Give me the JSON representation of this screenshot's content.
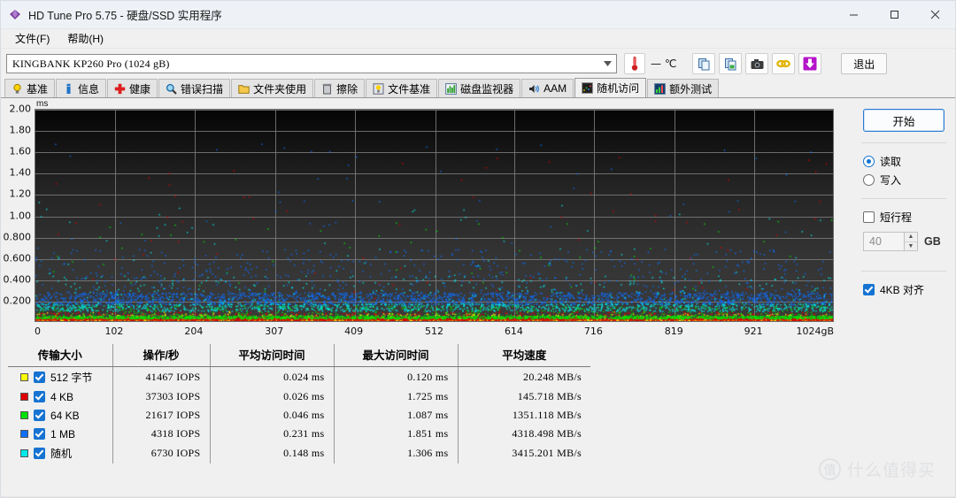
{
  "window": {
    "title": "HD Tune Pro 5.75 - 硬盘/SSD 实用程序",
    "app_icon": "hdtune-diamond-icon",
    "minimize": "—",
    "maximize": "☐",
    "close": "✕"
  },
  "menu": {
    "items": [
      {
        "label": "文件(F)",
        "name": "menu-file"
      },
      {
        "label": "帮助(H)",
        "name": "menu-help"
      }
    ]
  },
  "toolbar": {
    "drive": "KINGBANK KP260 Pro (1024 gB)",
    "dropdown_arrow": "▼",
    "temperature": "— ℃",
    "buttons": [
      {
        "name": "copy-button",
        "icon": "copy-icon"
      },
      {
        "name": "copy-image-button",
        "icon": "copy-image-icon"
      },
      {
        "name": "screenshot-button",
        "icon": "camera-icon"
      },
      {
        "name": "link-button",
        "icon": "link-icon"
      },
      {
        "name": "save-button",
        "icon": "download-arrow-icon"
      }
    ],
    "exit_label": "退出"
  },
  "tabs": [
    {
      "label": "基准",
      "icon": "bulb-icon",
      "active": false
    },
    {
      "label": "信息",
      "icon": "info-icon",
      "active": false
    },
    {
      "label": "健康",
      "icon": "health-cross-icon",
      "active": false
    },
    {
      "label": "错误扫描",
      "icon": "magnifier-icon",
      "active": false
    },
    {
      "label": "文件夹使用",
      "icon": "folder-icon",
      "active": false
    },
    {
      "label": "擦除",
      "icon": "trash-icon",
      "active": false
    },
    {
      "label": "文件基准",
      "icon": "file-benchmark-icon",
      "active": false
    },
    {
      "label": "磁盘监视器",
      "icon": "bar-chart-icon",
      "active": false
    },
    {
      "label": "AAM",
      "icon": "speaker-icon",
      "active": false
    },
    {
      "label": "随机访问",
      "icon": "random-access-icon",
      "active": true
    },
    {
      "label": "额外测试",
      "icon": "extra-tests-icon",
      "active": false
    }
  ],
  "chart_data": {
    "type": "scatter",
    "title": "",
    "ylabel": "ms",
    "xlabel": "gB",
    "ylim": [
      0,
      2.0
    ],
    "yticks": [
      "2.00",
      "1.80",
      "1.60",
      "1.40",
      "1.20",
      "1.00",
      "0.800",
      "0.600",
      "0.400",
      "0.200"
    ],
    "ytick_values": [
      2.0,
      1.8,
      1.6,
      1.4,
      1.2,
      1.0,
      0.8,
      0.6,
      0.4,
      0.2
    ],
    "xlim": [
      0,
      1024
    ],
    "xticks": [
      "0",
      "102",
      "204",
      "307",
      "409",
      "512",
      "614",
      "716",
      "819",
      "921",
      "1024gB"
    ],
    "xtick_values": [
      0,
      102,
      204,
      307,
      409,
      512,
      614,
      716,
      819,
      921,
      1024
    ],
    "grid": true,
    "legend_position": "below-table",
    "series": [
      {
        "name": "512 字节",
        "color": "#ffff00",
        "mean_ms": 0.024,
        "max_ms": 0.12,
        "band_ms": 0.03
      },
      {
        "name": "4 KB",
        "color": "#e00000",
        "mean_ms": 0.026,
        "max_ms": 1.725,
        "band_ms": 0.035
      },
      {
        "name": "64 KB",
        "color": "#00e000",
        "mean_ms": 0.046,
        "max_ms": 1.087,
        "band_ms": 0.055
      },
      {
        "name": "1 MB",
        "color": "#0d6efd",
        "mean_ms": 0.231,
        "max_ms": 1.851,
        "band_ms": 0.231
      },
      {
        "name": "随机",
        "color": "#00e8e8",
        "mean_ms": 0.148,
        "max_ms": 1.306,
        "band_ms": 0.148
      }
    ]
  },
  "results_table": {
    "columns": [
      "传输大小",
      "操作/秒",
      "平均访问时间",
      "最大访问时间",
      "平均速度"
    ],
    "rows": [
      {
        "size": "512 字节",
        "color": "#ffff00",
        "checked": true,
        "iops": "41467 IOPS",
        "avg_access": "0.024 ms",
        "max_access": "0.120 ms",
        "avg_speed": "20.248 MB/s"
      },
      {
        "size": "4 KB",
        "color": "#e00000",
        "checked": true,
        "iops": "37303 IOPS",
        "avg_access": "0.026 ms",
        "max_access": "1.725 ms",
        "avg_speed": "145.718 MB/s"
      },
      {
        "size": "64 KB",
        "color": "#00e000",
        "checked": true,
        "iops": "21617 IOPS",
        "avg_access": "0.046 ms",
        "max_access": "1.087 ms",
        "avg_speed": "1351.118 MB/s"
      },
      {
        "size": "1 MB",
        "color": "#0d6efd",
        "checked": true,
        "iops": "4318 IOPS",
        "avg_access": "0.231 ms",
        "max_access": "1.851 ms",
        "avg_speed": "4318.498 MB/s"
      },
      {
        "size": "随机",
        "color": "#00e8e8",
        "checked": true,
        "iops": "6730 IOPS",
        "avg_access": "0.148 ms",
        "max_access": "1.306 ms",
        "avg_speed": "3415.201 MB/s"
      }
    ]
  },
  "panel": {
    "start_label": "开始",
    "read_label": "读取",
    "write_label": "写入",
    "read_selected": true,
    "short_stroke_label": "短行程",
    "short_stroke_checked": false,
    "stroke_value": "40",
    "stroke_unit": "GB",
    "spin_up": "▲",
    "spin_down": "▼",
    "align_label": "4KB 对齐",
    "align_checked": true
  },
  "watermark": {
    "badge": "值",
    "text": "什么值得买"
  },
  "colors": {
    "accent": "#1673d2",
    "plot_bg": "#2a2a2a",
    "gridline": "#7d7d7d"
  }
}
